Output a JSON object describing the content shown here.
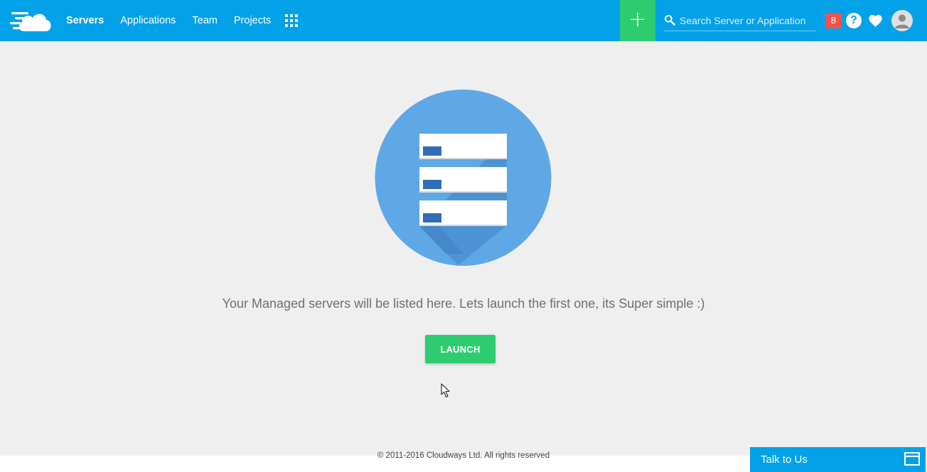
{
  "nav": {
    "items": [
      {
        "label": "Servers",
        "active": true
      },
      {
        "label": "Applications",
        "active": false
      },
      {
        "label": "Team",
        "active": false
      },
      {
        "label": "Projects",
        "active": false
      }
    ]
  },
  "header": {
    "add_label": "+",
    "search_placeholder": "Search Server or Application",
    "notification_count": "8",
    "help_label": "?"
  },
  "main": {
    "empty_message": "Your Managed servers will be listed here. Lets launch the first one, its Super simple :)",
    "launch_label": "LAUNCH"
  },
  "footer": {
    "copyright": "© 2011-2016 Cloudways Ltd. All rights reserved"
  },
  "chat": {
    "label": "Talk to Us"
  },
  "colors": {
    "topbar": "#03a1e8",
    "accent_green": "#2ecc71",
    "badge_red": "#ef5350",
    "hero_circle": "#5ea8e6",
    "bar_chip": "#2f6db5"
  },
  "icons": [
    "cloudways-logo",
    "apps-grid-icon",
    "plus-icon",
    "search-icon",
    "help-icon",
    "heart-icon",
    "user-avatar-icon",
    "server-stack-illustration",
    "chat-window-icon"
  ]
}
